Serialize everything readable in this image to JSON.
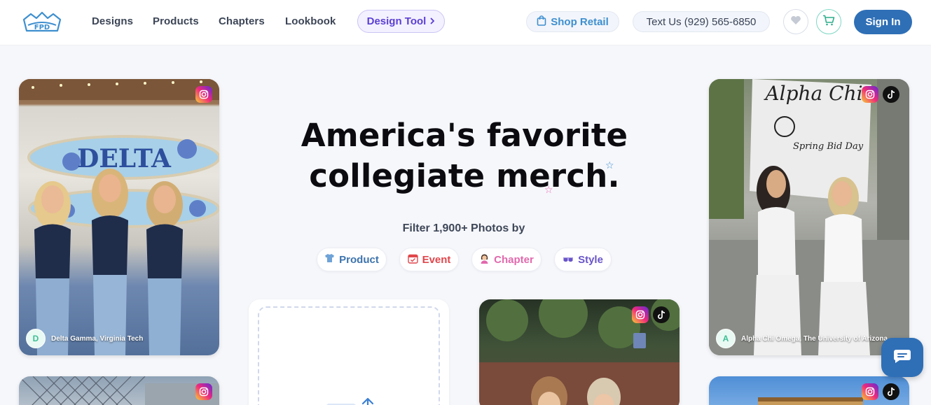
{
  "header": {
    "logo_icon": "fpd-crown-logo-icon",
    "nav": [
      {
        "label": "Designs"
      },
      {
        "label": "Products"
      },
      {
        "label": "Chapters"
      },
      {
        "label": "Lookbook"
      }
    ],
    "design_tool_label": "Design Tool",
    "shop_retail_label": "Shop Retail",
    "text_us_label": "Text Us (929) 565-6850",
    "sign_in_label": "Sign In",
    "accent_color": "#2f6fb6"
  },
  "hero": {
    "title_line1": "America's favorite",
    "title_line2": "collegiate merch.",
    "filter_label": "Filter 1,900+ Photos by",
    "filters": [
      {
        "label": "Product",
        "icon": "tshirt-icon",
        "color": "#3d74ad"
      },
      {
        "label": "Event",
        "icon": "calendar-icon",
        "color": "#e0464b"
      },
      {
        "label": "Chapter",
        "icon": "woman-emoji-icon",
        "color": "#e169ad"
      },
      {
        "label": "Style",
        "icon": "sunglasses-icon",
        "color": "#6a55c9"
      }
    ]
  },
  "gallery": {
    "cards": [
      {
        "avatar_letter": "D",
        "caption": "Delta Gamma, Virginia Tech",
        "banner_text": "DELTA"
      },
      {
        "avatar_letter": "A",
        "caption": "Alpha Chi Omega, The University of Arizona",
        "banner_text": "Alpha Chi",
        "banner_subtext": "Spring Bid Day"
      }
    ]
  }
}
